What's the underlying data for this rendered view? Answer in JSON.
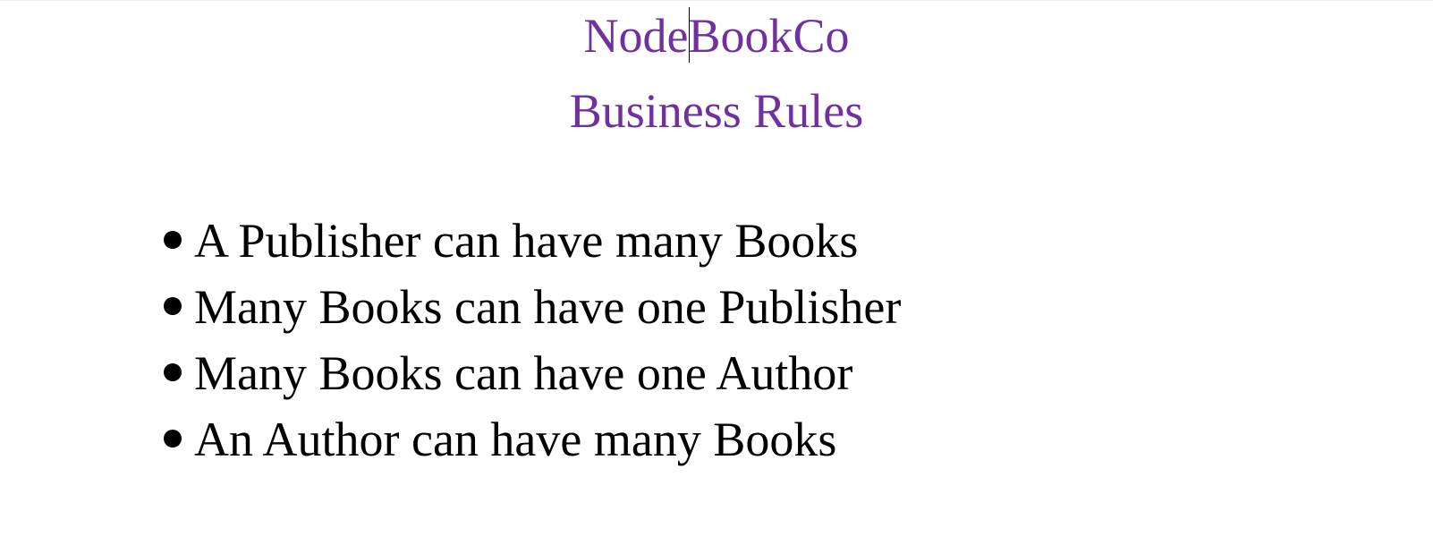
{
  "document": {
    "title": "NodeBookCo",
    "subtitle": "Business Rules",
    "heading_color": "#7030a0",
    "rules": [
      "A Publisher can have many Books",
      "Many Books can have one Publisher",
      "Many Books can have one Author",
      "An Author can have many Books"
    ]
  }
}
